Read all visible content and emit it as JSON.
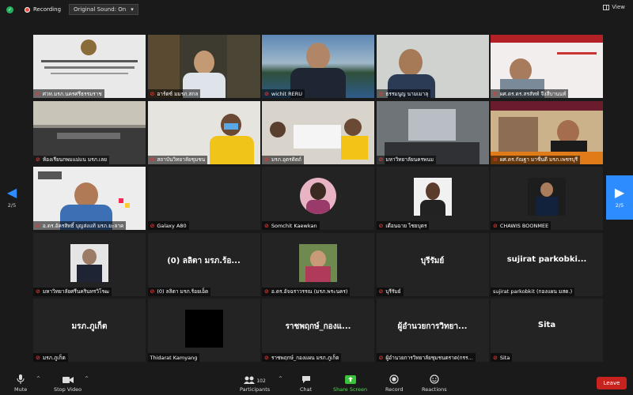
{
  "topbar": {
    "recording_label": "Recording",
    "original_sound_label": "Original Sound: On",
    "view_label": "View"
  },
  "pagination": {
    "left_label": "2/5",
    "right_label": "2/5"
  },
  "tiles": [
    {
      "name": "ศวท.มรภ.นครศรีธรรมราช",
      "mic_muted": true
    },
    {
      "name": "อาร์ตซ์ มมรภ.สกล",
      "mic_muted": true
    },
    {
      "name": "wichit RERU",
      "mic_muted": true
    },
    {
      "name": "ธรรมนูญ นามเมาลุ",
      "mic_muted": true
    },
    {
      "name": "ผศ.ดร.ดร.สรสัทท์ จึงสืบานนท์",
      "mic_muted": true
    },
    {
      "name": "ห้องเรียนกพมแม่แน มรภ.เลย",
      "mic_muted": true
    },
    {
      "name": "สถาบันวิทยาลัยชุมชน",
      "mic_muted": true
    },
    {
      "name": "มรภ.อุตรดิตถ์",
      "mic_muted": true
    },
    {
      "name": "มหาวิทยาลัยนครพนม",
      "mic_muted": true
    },
    {
      "name": "ผศ.ดร.กัณฐา มาชื่นดี มรภ.เพชรบุรี",
      "mic_muted": true
    },
    {
      "name": "อ.ดร.อัครสิทธิ์ บุญส่งแท้ มรภ.ยะลาค",
      "mic_muted": true
    },
    {
      "name": "Galaxy A80",
      "mic_muted": true
    },
    {
      "name": "Somchit Kaewkan",
      "mic_muted": true
    },
    {
      "name": "เดือนฉาย ไชยบุตร",
      "mic_muted": true
    },
    {
      "name": "CHAWIS BOONMEE",
      "mic_muted": true
    },
    {
      "name": "มหาวิทยาลัยศรีนครินทรวิโรฒ",
      "mic_muted": true
    },
    {
      "name": "(0) ลลิตา มรภ.ร้อยเอ็ด",
      "big_name": "(0) ลลิตา มรภ.ร้อ...",
      "mic_muted": true
    },
    {
      "name": "อ.ดร.อัจฉราวรรณ (มรภ.พระนคร)",
      "mic_muted": true
    },
    {
      "name": "บุรีรัมย์",
      "big_name": "บุรีรัมย์",
      "mic_muted": true
    },
    {
      "name": "sujirat parkobkit (กองแผน มสด.)",
      "big_name": "sujirat  parkobki...",
      "mic_muted": false
    },
    {
      "name": "มรภ.ภูเก็ต",
      "big_name": "มรภ.ภูเก็ต",
      "mic_muted": true
    },
    {
      "name": "Thidarat Kamyang",
      "mic_muted": false
    },
    {
      "name": "ราชพฤกษ์_กองแผน มรภ.ภูเก็ต",
      "big_name": "ราชพฤกษ์_กองแ...",
      "mic_muted": true
    },
    {
      "name": "ผู้อำนวยการวิทยาลัยชุมชนตราด(กรร...",
      "big_name": "ผู้อำนวยการวิทยา...",
      "mic_muted": true
    },
    {
      "name": "Sita",
      "big_name": "Sita",
      "mic_muted": true
    }
  ],
  "toolbar": {
    "mute_label": "Mute",
    "stop_video_label": "Stop Video",
    "participants_label": "Participants",
    "participants_count": "102",
    "chat_label": "Chat",
    "share_screen_label": "Share Screen",
    "record_label": "Record",
    "reactions_label": "Reactions",
    "leave_label": "Leave"
  },
  "colors": {
    "accent": "#2d8cff",
    "share_green": "#5bd65b",
    "leave_red": "#c8221e",
    "muted_red": "#e53935"
  }
}
